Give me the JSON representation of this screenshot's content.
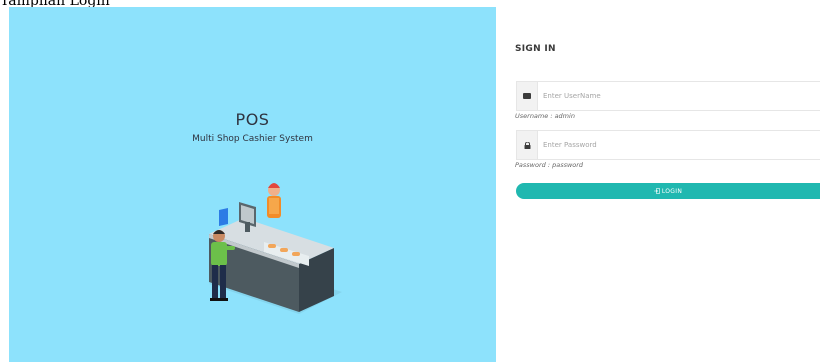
{
  "caption": "Tampilan Login",
  "hero": {
    "title": "POS",
    "subtitle": "Multi Shop Cashier System",
    "background": "#8de2fc",
    "illustration_icon": "cashier-counter-illustration"
  },
  "signin": {
    "title": "SIGN IN",
    "username": {
      "icon": "user-card-icon",
      "placeholder": "Enter UserName",
      "value": "",
      "hint": "Username : admin"
    },
    "password": {
      "icon": "lock-icon",
      "placeholder": "Enter Password",
      "value": "",
      "hint": "Password : password"
    },
    "login_button": {
      "icon": "login-icon",
      "label": "LOGIN",
      "color": "#20b8b0"
    }
  }
}
